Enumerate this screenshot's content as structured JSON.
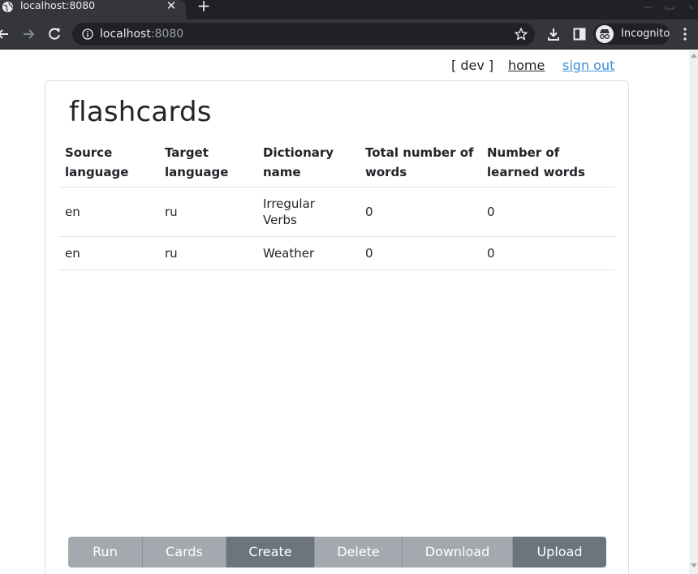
{
  "browser": {
    "tab_title": "localhost:8080",
    "tab_close": "✕",
    "new_tab": "+",
    "url_host": "localhost",
    "url_port": ":8080",
    "profile_label": "Incognito"
  },
  "nav": {
    "env": "[ dev ]",
    "home": "home",
    "sign_out": "sign out"
  },
  "page": {
    "title": "flashcards"
  },
  "table": {
    "headers": [
      "Source language",
      "Target language",
      "Dictionary name",
      "Total number of words",
      "Number of learned words"
    ],
    "rows": [
      [
        "en",
        "ru",
        "Irregular Verbs",
        "0",
        "0"
      ],
      [
        "en",
        "ru",
        "Weather",
        "0",
        "0"
      ]
    ]
  },
  "actions": {
    "run": "Run",
    "cards": "Cards",
    "create": "Create",
    "delete": "Delete",
    "download": "Download",
    "upload": "Upload"
  },
  "colors": {
    "button_light": "#a3a9ae",
    "button_dark": "#6c757d",
    "link": "#3a8fd6"
  }
}
